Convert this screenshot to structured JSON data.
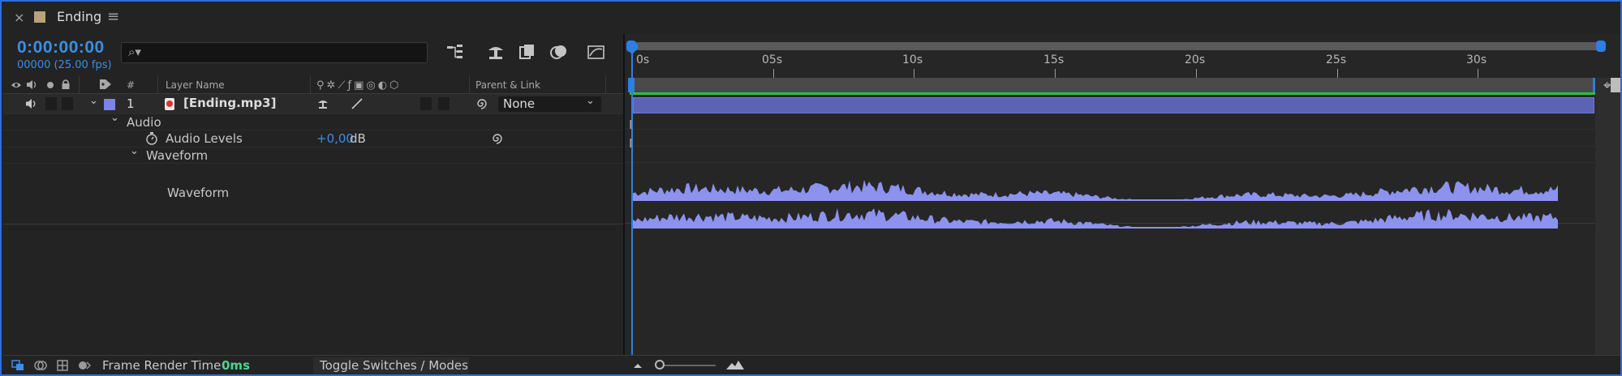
{
  "tab": {
    "close_glyph": "×",
    "title": "Ending",
    "menu_glyph": "≡",
    "swatch_color": "#b8a27a"
  },
  "timecode": {
    "value": "0:00:00:00",
    "frames_fps": "00000 (25.00 fps)"
  },
  "search": {
    "glyph": "⌕▾",
    "placeholder": ""
  },
  "columns": {
    "hash": "#",
    "layer_name": "Layer Name",
    "parent_link": "Parent & Link"
  },
  "layer": {
    "index": "1",
    "name": "[Ending.mp3]",
    "label_color": "#7d83e8",
    "parent_value": "None"
  },
  "properties": {
    "audio_group": "Audio",
    "audio_levels_label": "Audio Levels",
    "audio_levels_value": "+0,00",
    "audio_levels_unit": "dB",
    "waveform_group": "Waveform",
    "waveform_label": "Waveform"
  },
  "ruler": {
    "labels": [
      "0s",
      "05s",
      "10s",
      "15s",
      "20s",
      "25s",
      "30s"
    ]
  },
  "bottom": {
    "frame_render_label": "Frame Render Time",
    "frame_render_value": "0ms",
    "toggle_label": "Toggle Switches / Modes"
  },
  "colors": {
    "accent_blue": "#2d7fe3",
    "waveform": "#8c92ee",
    "layer_bar": "#5c63b4",
    "render_time_green": "#4fd38a",
    "work_area_green": "#2fbf3a"
  }
}
